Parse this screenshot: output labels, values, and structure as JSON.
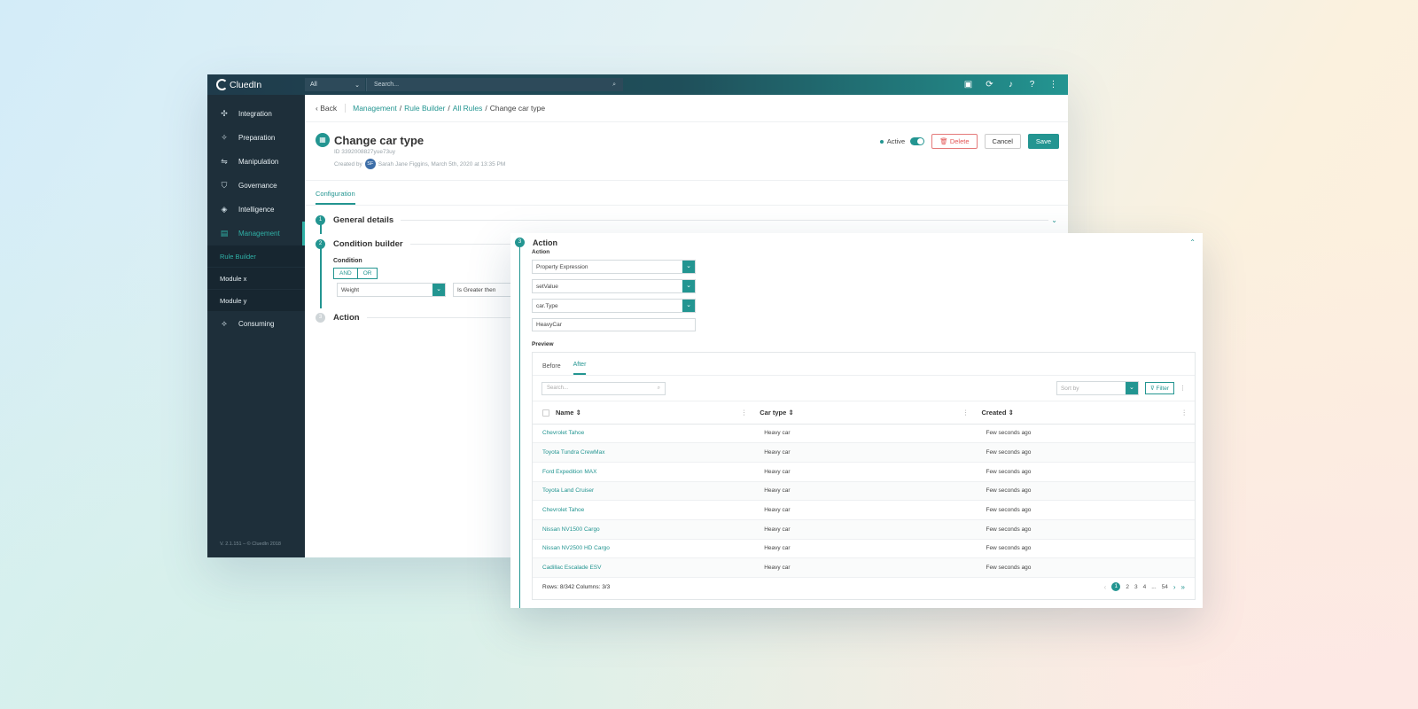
{
  "app": {
    "logo": "CluedIn",
    "version": "V. 2.1.151 – © CluedIn 2018"
  },
  "topbar": {
    "scope": "All",
    "search_placeholder": "Search..."
  },
  "sidebar": {
    "items": [
      {
        "label": "Integration",
        "icon": "integration-icon"
      },
      {
        "label": "Preparation",
        "icon": "preparation-icon"
      },
      {
        "label": "Manipulation",
        "icon": "manipulation-icon"
      },
      {
        "label": "Governance",
        "icon": "governance-icon"
      },
      {
        "label": "Intelligence",
        "icon": "intelligence-icon"
      },
      {
        "label": "Management",
        "icon": "management-icon",
        "active": true
      }
    ],
    "sub_items": [
      "Rule Builder",
      "Module x",
      "Module y"
    ],
    "bottom_item": "Consuming"
  },
  "breadcrumb": {
    "back": "Back",
    "links": [
      "Management",
      "Rule Builder",
      "All Rules"
    ],
    "current": "Change car type"
  },
  "rule": {
    "title": "Change car type",
    "id": "ID 3392008827yue73uy",
    "created_by_label": "Created by",
    "avatar_initials": "SF",
    "created_by": "Sarah Jane Figgins, March 5th, 2020 at 13:35 PM",
    "active_label": "Active",
    "delete_label": "Delete",
    "cancel_label": "Cancel",
    "save_label": "Save"
  },
  "tabs": {
    "configuration": "Configuration"
  },
  "steps": {
    "s1_num": "1",
    "s1_label": "General details",
    "s2_num": "2",
    "s2_label": "Condition builder",
    "s3_num": "3",
    "s3_label": "Action"
  },
  "condition": {
    "label": "Condition",
    "and": "AND",
    "or": "OR",
    "field": "Weight",
    "operator": "Is Greater then"
  },
  "action_panel": {
    "num": "3",
    "title": "Action",
    "label": "Action",
    "select1": "Property Expression",
    "select2": "setValue",
    "select3": "car.Type",
    "value": "HeavyCar",
    "preview_label": "Preview",
    "tab_before": "Before",
    "tab_after": "After",
    "search_placeholder": "Search...",
    "sort_placeholder": "Sort by",
    "filter_label": "Filter",
    "columns": [
      "Name",
      "Car type",
      "Created"
    ],
    "rows": [
      {
        "name": "Chevrolet Tahoe",
        "type": "Heavy car",
        "created": "Few seconds ago"
      },
      {
        "name": "Toyota Tundra CrewMax",
        "type": "Heavy car",
        "created": "Few seconds ago"
      },
      {
        "name": "Ford Expedition MAX",
        "type": "Heavy car",
        "created": "Few seconds ago"
      },
      {
        "name": "Toyota Land Cruiser",
        "type": "Heavy car",
        "created": "Few seconds ago"
      },
      {
        "name": "Chevrolet Tahoe",
        "type": "Heavy car",
        "created": "Few seconds ago"
      },
      {
        "name": "Nissan NV1500 Cargo",
        "type": "Heavy car",
        "created": "Few seconds ago"
      },
      {
        "name": "Nissan NV2500 HD Cargo",
        "type": "Heavy car",
        "created": "Few seconds ago"
      },
      {
        "name": "Cadillac Escalade ESV",
        "type": "Heavy car",
        "created": "Few seconds ago"
      }
    ],
    "footer": "Rows: 8/342 Columns: 3/3",
    "pages": [
      "1",
      "2",
      "3",
      "4",
      "...",
      "54"
    ]
  },
  "colors": {
    "accent": "#239591",
    "sidebar": "#1e2f3a",
    "danger": "#e25555"
  }
}
